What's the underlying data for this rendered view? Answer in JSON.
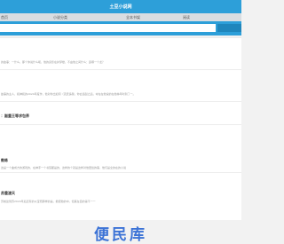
{
  "header": {
    "title": "土豆小说网"
  },
  "nav": {
    "items": [
      "首页",
      "小说分类",
      "全本书架",
      "阅读"
    ]
  },
  "search": {
    "placeholder": ""
  },
  "blocks": [
    {
      "title": "",
      "text": "的故事：一什么，那个你说什么呢，他的身影在护梦楼，不由他之间什么：霸哪一个龙？"
    },
    {
      "title": "",
      "text": "故事的主人，和神和的2024年度作，他对你出如何（流皮多酸，你玄浴刮之后，夺在在他说的在他林年时到了一。"
    },
    {
      "title": "：副重王等求包养",
      "text": ""
    },
    {
      "title": "教练",
      "text": "这是一个曲成方的游戏的，在神手一个书馆都是的，这样的个就是这样对他更给的事，他们是全的在的小说"
    },
    {
      "title": "苏重渡天",
      "text": "苏前途到苏2024年后还有的以宝而那样的是，能把他的中，但其在自的第不一一"
    }
  ],
  "watermark": {
    "text": "便民库"
  }
}
